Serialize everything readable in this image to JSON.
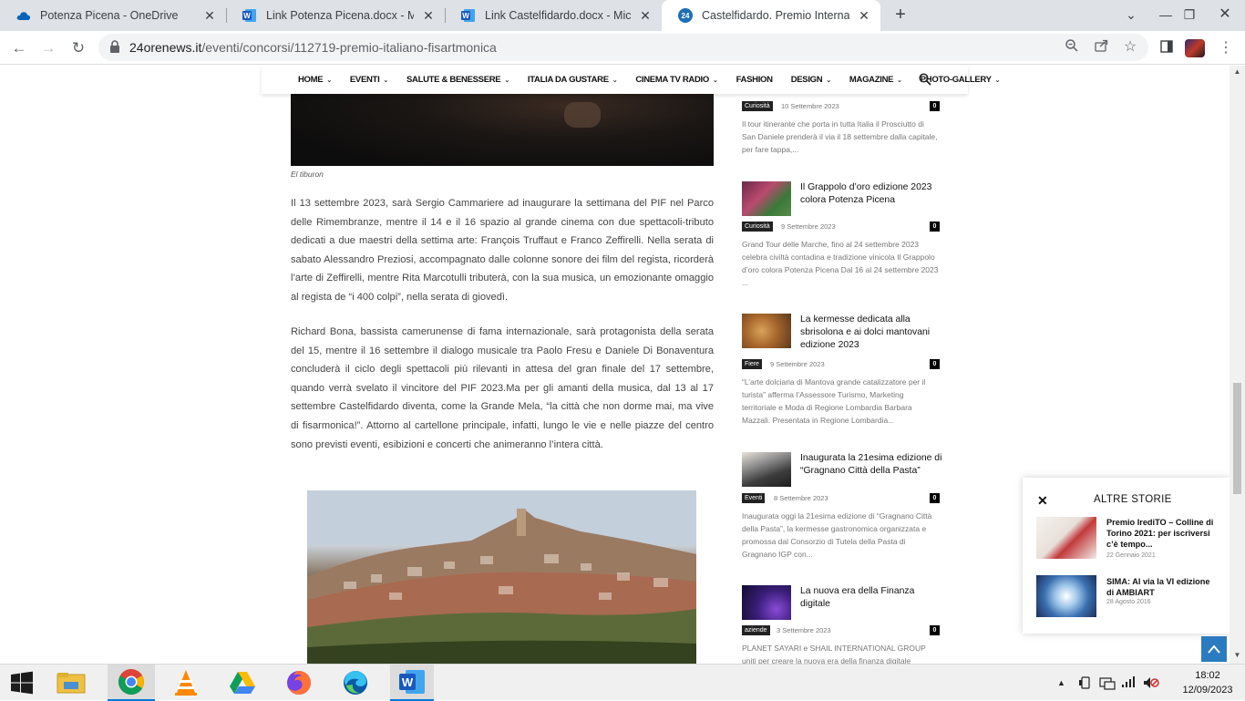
{
  "browser": {
    "tabs": [
      {
        "title": "Potenza Picena - OneDrive",
        "icon": "onedrive-icon"
      },
      {
        "title": "Link Potenza Picena.docx - Micro",
        "icon": "word-icon"
      },
      {
        "title": "Link Castelfidardo.docx - Microso",
        "icon": "word-icon"
      },
      {
        "title": "Castelfidardo. Premio Internazion",
        "icon": "24orenews-icon",
        "active": true
      }
    ],
    "url_host": "24orenews.it",
    "url_path": "/eventi/concorsi/112719-premio-italiano-fisartmonica"
  },
  "site_nav": {
    "items": [
      {
        "label": "HOME",
        "dropdown": true
      },
      {
        "label": "EVENTI",
        "dropdown": true
      },
      {
        "label": "SALUTE & BENESSERE",
        "dropdown": true
      },
      {
        "label": "ITALIA DA GUSTARE",
        "dropdown": true
      },
      {
        "label": "CINEMA TV RADIO",
        "dropdown": true
      },
      {
        "label": "FASHION",
        "dropdown": false
      },
      {
        "label": "DESIGN",
        "dropdown": true
      },
      {
        "label": "MAGAZINE",
        "dropdown": true
      },
      {
        "label": "PHOTO-GALLERY",
        "dropdown": true
      }
    ]
  },
  "article": {
    "hero_caption": "El tiburon",
    "paragraphs": [
      "Il 13 settembre 2023, sarà Sergio Cammariere ad inaugurare la settimana del PIF nel Parco delle Rimembranze, mentre il 14 e il 16 spazio al grande cinema con due spettacoli-tributo dedicati a due maestri della settima arte: François Truffaut e Franco Zeffirelli. Nella serata di sabato Alessandro Preziosi, accompagnato dalle colonne sonore dei film del regista, ricorderà l’arte di Zeffirelli, mentre Rita Marcotulli tributerà, con la sua musica, un emozionante omaggio al regista de “i 400 colpi”, nella serata di giovedì.",
      "Richard Bona, bassista camerunense di fama internazionale, sarà protagonista della serata del 15, mentre il 16 settembre il dialogo musicale tra Paolo Fresu e Daniele Di Bonaventura concluderà il ciclo degli spettacoli più rilevanti in attesa del gran finale del 17 settembre, quando verrà svelato il vincitore del PIF 2023.Ma per gli amanti della musica, dal 13 al 17 settembre Castelfidardo diventa, come la Grande Mela, “la città che non dorme mai, ma vive di fisarmonica!”. Attorno al cartellone principale, infatti, lungo le vie e nelle piazze del centro sono previsti eventi, esibizioni e concerti che animeranno l’intera città."
    ]
  },
  "sidebar": {
    "top_meta": {
      "category": "Curiosità",
      "date": "10 Settembre 2023",
      "count": "0"
    },
    "top_excerpt": "Il tour itinerante che porta in tutta Italia il Prosciutto di San Daniele prenderà il via il 18 settembre dalla capitale, per fare tappa,...",
    "items": [
      {
        "title": "Il Grappolo d’oro edizione 2023 colora Potenza Picena",
        "category": "Curiosità",
        "date": "9 Settembre 2023",
        "count": "0",
        "excerpt": "Grand Tour delle Marche, fino al 24 settembre 2023 celebra civiltà contadina e tradizione vinicola Il Grappolo d’oro colora Potenza Picena Dal 16 al 24 settembre 2023 ..."
      },
      {
        "title": "La kermesse dedicata alla sbrisolona e ai dolci mantovani edizione 2023",
        "category": "Fiere",
        "date": "9 Settembre 2023",
        "count": "0",
        "excerpt": "“L’arte dolciaria di Mantova grande catalizzatore per il turista” afferma l’Assessore Turismo, Marketing territoriale e Moda di Regione Lombardia Barbara Mazzali. Presentata in Regione Lombardia..."
      },
      {
        "title": "Inaugurata la 21esima edizione di “Gragnano Città della Pasta”",
        "category": "Eventi",
        "date": "8 Settembre 2023",
        "count": "0",
        "excerpt": "Inaugurata oggi la 21esima edizione di “Gragnano Città della Pasta”, la kermesse gastronomica organizzata e promossa dal Consorzio di Tutela della Pasta di Gragnano IGP con..."
      },
      {
        "title": "La nuova era della Finanza digitale",
        "category": "aziende",
        "date": "3 Settembre 2023",
        "count": "0",
        "excerpt": "PLANET SAYARI e SHAIL INTERNATIONAL GROUP uniti per creare la nuova era della finanza digitale"
      }
    ]
  },
  "altre_storie": {
    "header": "ALTRE STORIE",
    "items": [
      {
        "title": "Premio IrediTO – Colline di Torino 2021: per iscriversi c’è tempo...",
        "date": "22 Gennaio 2021"
      },
      {
        "title": "SIMA: Al via la VI edizione di AMBIART",
        "date": "28 Agosto 2016"
      }
    ]
  },
  "taskbar": {
    "time": "18:02",
    "date": "12/09/2023"
  }
}
